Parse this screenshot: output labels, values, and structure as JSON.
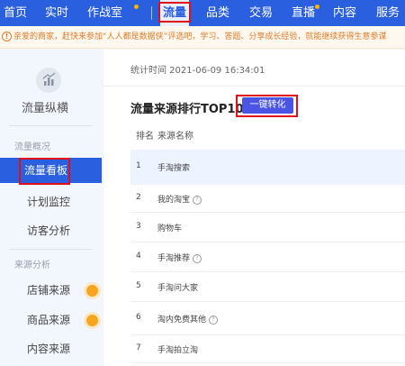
{
  "topnav": {
    "items": [
      "首页",
      "实时",
      "作战室",
      "流量",
      "品类",
      "交易",
      "直播",
      "内容",
      "服务"
    ],
    "active": "流量"
  },
  "notice": {
    "icon": "!",
    "text": "亲爱的商家，赶快来参加“人人都是数据侠”评选吧，学习、答题、分享成长经验，就能继续获得生意参谋"
  },
  "sidebar": {
    "title": "流量纵横",
    "section1": "流量概况",
    "items1": [
      "流量看板",
      "计划监控",
      "访客分析"
    ],
    "active_item": "流量看板",
    "section2": "来源分析",
    "items2": [
      "店铺来源",
      "商品来源",
      "内容来源"
    ]
  },
  "main": {
    "stat_time": "统计时间 2021-06-09 16:34:01",
    "panel_title": "流量来源排行TOP10",
    "convert_button": "一键转化",
    "table": {
      "headers": [
        "排名",
        "来源名称"
      ],
      "rows": [
        {
          "rank": "1",
          "name": "手淘搜索",
          "help": false
        },
        {
          "rank": "2",
          "name": "我的淘宝",
          "help": true
        },
        {
          "rank": "3",
          "name": "购物车",
          "help": false
        },
        {
          "rank": "4",
          "name": "手淘推荐",
          "help": true
        },
        {
          "rank": "5",
          "name": "手淘问大家",
          "help": false
        },
        {
          "rank": "6",
          "name": "淘内免费其他",
          "help": true
        },
        {
          "rank": "7",
          "name": "手淘拍立淘",
          "help": false
        }
      ]
    }
  },
  "colors": {
    "nav_blue": "#2a5fe0",
    "highlight_red": "#e0101b",
    "button_blue": "#4a55e6",
    "notice_orange": "#e07b2b",
    "dot_orange": "#f7a520"
  }
}
